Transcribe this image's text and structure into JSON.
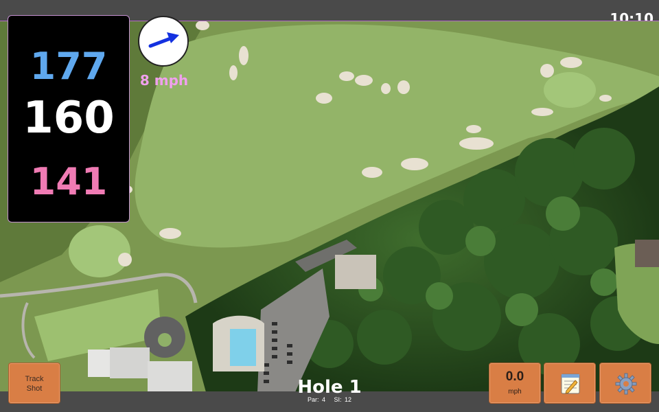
{
  "status": {
    "time": "10:10"
  },
  "yardage": {
    "back": "177",
    "middle": "160",
    "front": "141"
  },
  "wind": {
    "speed": "8 mph",
    "icon": "wind-arrow-icon"
  },
  "buttons": {
    "track_shot": [
      "Track",
      "Shot"
    ],
    "shot_speed": {
      "value": "0.0",
      "unit": "mph"
    },
    "notes_icon": "notepad-icon",
    "settings_icon": "gear-icon"
  },
  "hole": {
    "title": "Hole 1",
    "par_label": "Par: 4",
    "si_label": "SI: 12"
  },
  "colors": {
    "back": "#5fa8ee",
    "middle": "#ffffff",
    "front": "#f07bb4",
    "button": "#d97e45",
    "wind_text": "#f0a0ee"
  }
}
